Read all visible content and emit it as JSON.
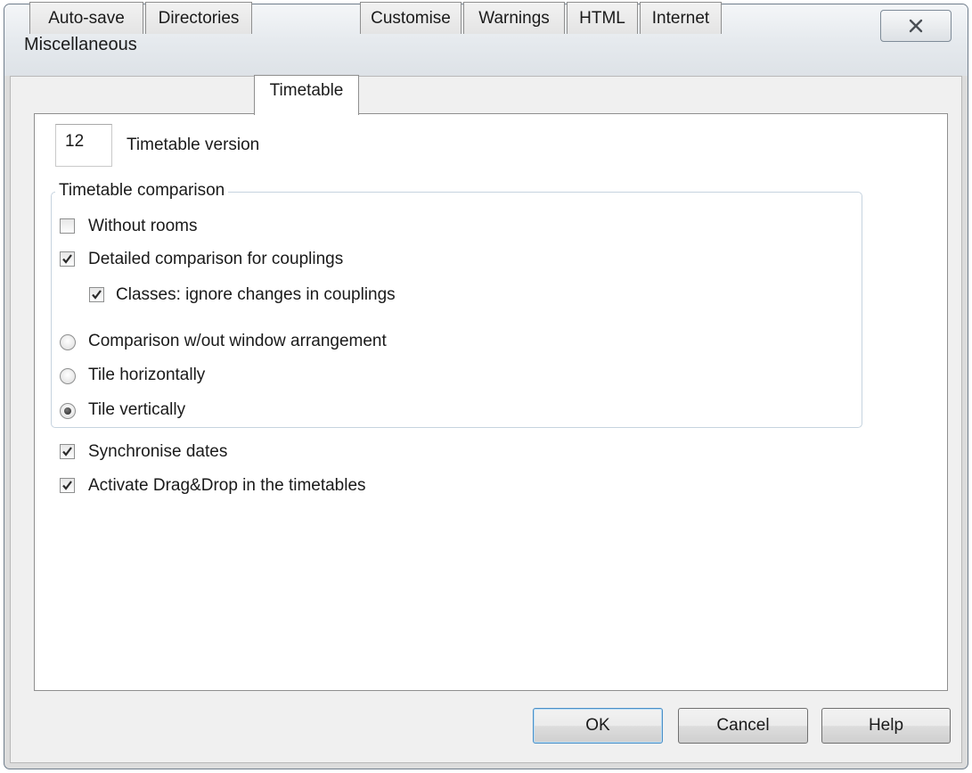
{
  "window": {
    "title": "Miscellaneous",
    "close_icon": "close-x-icon"
  },
  "tabs": [
    {
      "label": "Auto-save",
      "active": false
    },
    {
      "label": "Directories",
      "active": false
    },
    {
      "label": "Timetable",
      "active": true
    },
    {
      "label": "Customise",
      "active": false
    },
    {
      "label": "Warnings",
      "active": false
    },
    {
      "label": "HTML",
      "active": false
    },
    {
      "label": "Internet",
      "active": false
    }
  ],
  "version": {
    "value": "12",
    "label": "Timetable version"
  },
  "comparison": {
    "group_label": "Timetable comparison",
    "without_rooms": {
      "label": "Without rooms",
      "checked": false
    },
    "detailed": {
      "label": "Detailed comparison for couplings",
      "checked": true
    },
    "classes_ignore": {
      "label": "Classes: ignore changes in couplings",
      "checked": true
    },
    "arrangement_options": [
      {
        "label": "Comparison w/out window arrangement",
        "selected": false
      },
      {
        "label": "Tile horizontally",
        "selected": false
      },
      {
        "label": "Tile vertically",
        "selected": true
      }
    ]
  },
  "options": {
    "synchronise": {
      "label": "Synchronise dates",
      "checked": true
    },
    "drag_drop": {
      "label": "Activate Drag&Drop in the timetables",
      "checked": true
    }
  },
  "buttons": {
    "ok": "OK",
    "cancel": "Cancel",
    "help": "Help"
  }
}
